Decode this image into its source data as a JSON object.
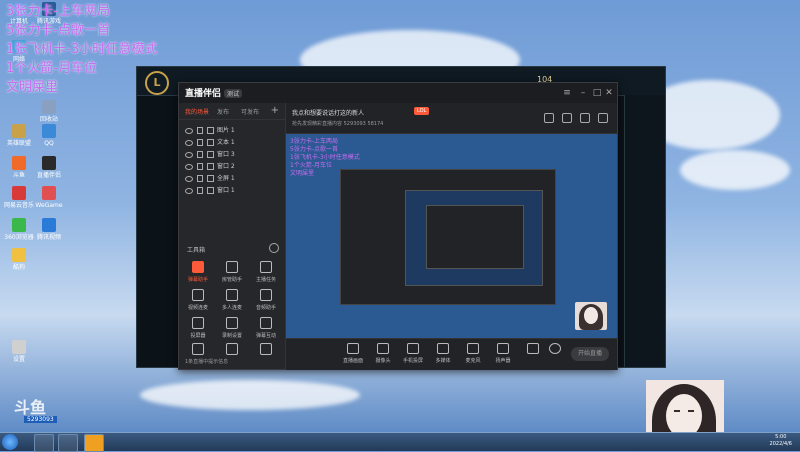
{
  "overlay": {
    "lines": [
      "3张力卡-上车两局",
      "5张力卡-点歌一首",
      "1张飞机卡-3小时任意模式",
      "1个火箭-月车位",
      "文明屎里"
    ]
  },
  "desktop": {
    "icons": [
      "计算机",
      "腾讯游戏",
      "网络",
      "回收站",
      "英雄联盟",
      "QQ",
      "斗鱼",
      "直播伴侣",
      "网易云音乐",
      "WeGame",
      "360浏览器",
      "腾讯视频",
      "酷狗",
      "设置"
    ]
  },
  "lol": {
    "stat": "104"
  },
  "app": {
    "title": "直播伴侣",
    "badge": "测试",
    "tabs": [
      "我的场景",
      "发布",
      "可发布"
    ],
    "scenes": [
      "图片 1",
      "文本 1",
      "窗口 3",
      "窗口 2",
      "全屏 1",
      "窗口 1"
    ],
    "tools_title": "工具箱",
    "tools": [
      "弹幕助手",
      "房管助手",
      "主播任务",
      "视频连麦",
      "多人连麦",
      "音频助手",
      "投屏器",
      "录制设置",
      "弹幕互动",
      "虚拟形象",
      "礼物特效",
      "更多"
    ],
    "side_footer": "1条直播中提示信息",
    "info_title": "我点和想要说话打这的新人",
    "info_tag": "LOL",
    "info_sub": "抢先发现精彩直播内容  5293093   58174",
    "preview_overlay": [
      "3张力卡-上车两局",
      "5张力卡-点歌一首",
      "1张飞机卡-3小时任意模式",
      "1个火箭-月车位",
      "文明屎里"
    ],
    "bottom_buttons": [
      "直播画面",
      "摄像头",
      "手机投屏",
      "多媒体",
      "麦克风",
      "扬声器"
    ],
    "start_label": "开始直播"
  },
  "watermark": {
    "brand": "斗鱼",
    "room_id": "5293093"
  },
  "taskbar": {
    "time": "5:00",
    "date": "2022/4/6"
  },
  "colors": {
    "accent": "#ff5a3a",
    "overlay_text": "#c86cf0",
    "window_bg": "#222327"
  }
}
